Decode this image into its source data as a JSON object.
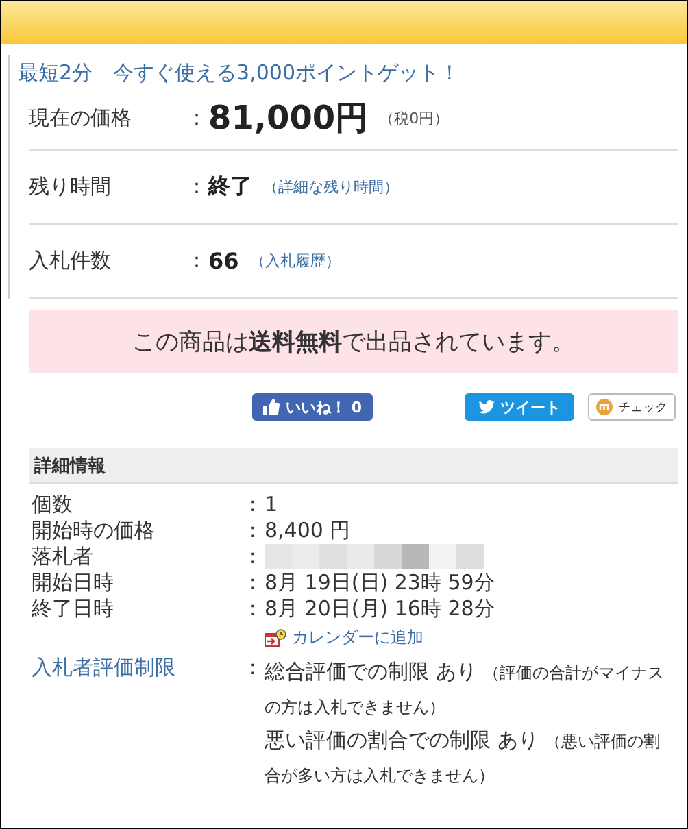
{
  "promo": {
    "text": "最短2分　今すぐ使える3,000ポイントゲット！"
  },
  "summary": [
    {
      "label": "現在の価格",
      "separator": "：",
      "kind": "price",
      "value": "81,000円",
      "note": "（税0円）",
      "note_link": false
    },
    {
      "label": "残り時間",
      "separator": "：",
      "kind": "text",
      "value": "終了",
      "note": "（詳細な残り時間）",
      "note_link": true
    },
    {
      "label": "入札件数",
      "separator": "：",
      "kind": "text",
      "value": "66",
      "note": "（入札履歴）",
      "note_link": true
    }
  ],
  "notice": {
    "text": "この商品は**送料無料**で出品されています。"
  },
  "social": [
    {
      "kind": "like",
      "label": "いいね！",
      "count": "0"
    },
    {
      "kind": "tweet",
      "label": "ツイート"
    },
    {
      "kind": "check",
      "label": "チェック"
    }
  ],
  "details": {
    "title": "詳細情報",
    "rows": [
      {
        "label": "個数",
        "separator": "：",
        "label_link": false,
        "kind": "text",
        "value": "1"
      },
      {
        "label": "開始時の価格",
        "separator": "：",
        "label_link": false,
        "kind": "text",
        "value": "8,400 円"
      },
      {
        "label": "落札者",
        "separator": "：",
        "label_link": false,
        "kind": "redacted"
      },
      {
        "label": "開始日時",
        "separator": "：",
        "label_link": false,
        "kind": "text",
        "value": "8月 19日(日) 23時 59分"
      },
      {
        "label": "終了日時",
        "separator": "：",
        "label_link": false,
        "kind": "text",
        "value": "8月 20日(月) 16時 28分",
        "calendar_link": "カレンダーに追加"
      },
      {
        "label": "入札者評価制限",
        "separator": "：",
        "label_link": true,
        "kind": "restrictions",
        "items": [
          {
            "text": "総合評価での制限 あり",
            "note": "（評価の合計がマイナスの方は入札できません）"
          },
          {
            "text": "悪い評価の割合での制限 あり",
            "note": "（悪い評価の割合が多い方は入札できません）"
          }
        ]
      }
    ]
  }
}
